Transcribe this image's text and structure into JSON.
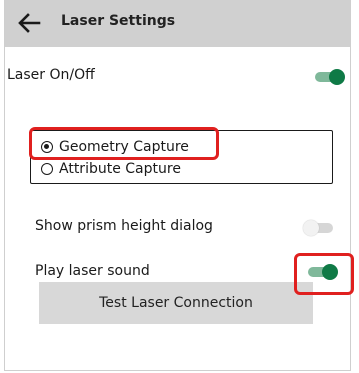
{
  "header": {
    "title": "Laser Settings",
    "back_icon": "arrow-left-icon"
  },
  "settings": {
    "laser_on_off": {
      "label": "Laser On/Off",
      "state": "on"
    },
    "capture_mode": {
      "options": [
        {
          "label": "Geometry Capture",
          "selected": true
        },
        {
          "label": "Attribute Capture",
          "selected": false
        }
      ]
    },
    "show_prism_height_dialog": {
      "label": "Show prism height dialog",
      "state": "off"
    },
    "play_laser_sound": {
      "label": "Play laser sound",
      "state": "on"
    }
  },
  "actions": {
    "test_connection_label": "Test Laser Connection"
  },
  "colors": {
    "header_bg": "#d0d0d0",
    "toggle_on": "#0f7a46",
    "highlight": "#e0201f",
    "button_bg": "#d8d8d8"
  }
}
